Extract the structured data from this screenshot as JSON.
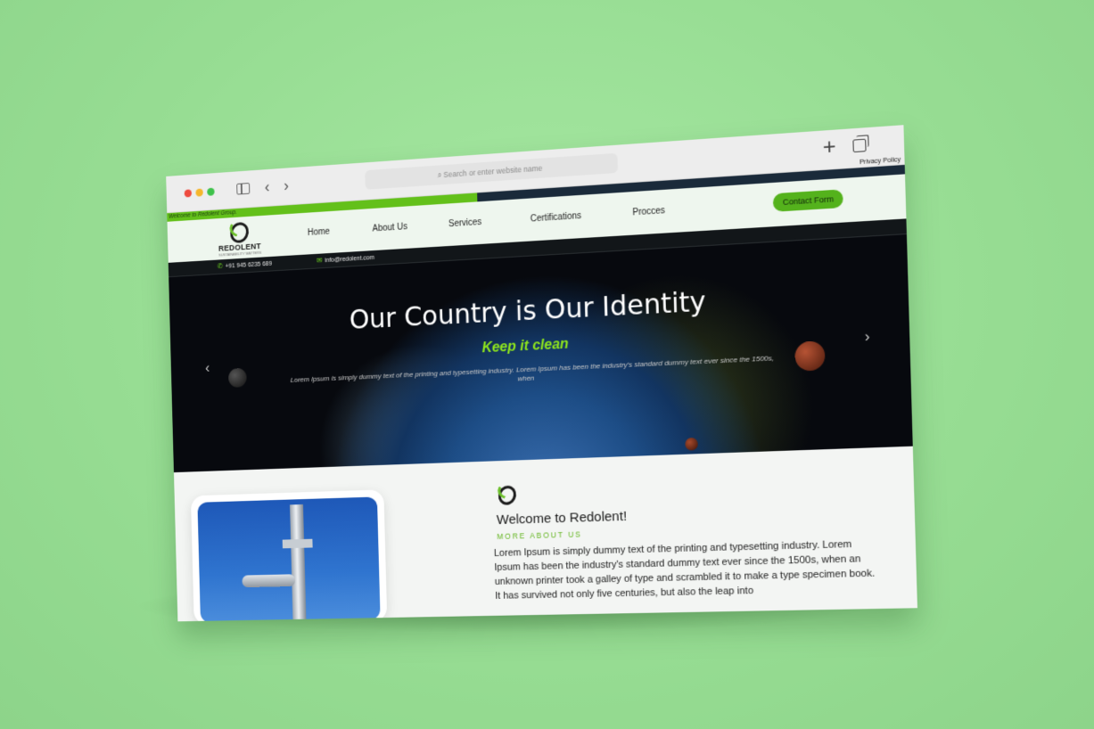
{
  "browser": {
    "address_placeholder": "Search or enter website name"
  },
  "topbar": {
    "welcome": "Welcome to Redolent Group.",
    "privacy": "Privacy Policy"
  },
  "header": {
    "logo_name": "REDOLENT",
    "logo_tagline": "SUSTAINABILITY MATTERS",
    "nav": [
      "Home",
      "About Us",
      "Services",
      "Certifications",
      "Procces"
    ],
    "cta": "Contact Form"
  },
  "contact": {
    "phone": "+91 945 6235 689",
    "email": "info@redolent.com"
  },
  "hero": {
    "title": "Our Country is Our Identity",
    "subtitle": "Keep it clean",
    "text": "Lorem Ipsum is simply dummy text of the printing and typesetting industry. Lorem Ipsum has been the industry's standard dummy text ever since the 1500s, when"
  },
  "about": {
    "title": "Welcome to Redolent!",
    "kicker": "MORE ABOUT US",
    "text": "Lorem Ipsum is simply dummy text of the printing and typesetting industry. Lorem Ipsum has been the industry's standard dummy text ever since the 1500s, when an unknown printer took a galley of type and scrambled it to make a type specimen book. It has survived not only five centuries, but also the leap into"
  },
  "colors": {
    "background": "#97dd93",
    "accent": "#63c01a",
    "hero_bg": "#07090e"
  }
}
